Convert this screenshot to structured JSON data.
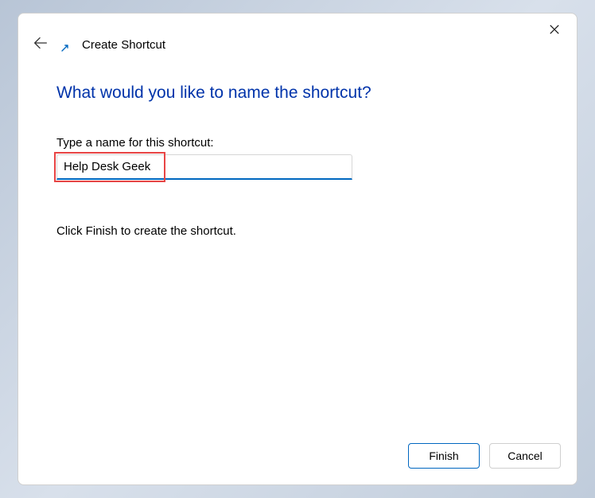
{
  "header": {
    "title": "Create Shortcut"
  },
  "main": {
    "heading": "What would you like to name the shortcut?",
    "field_label": "Type a name for this shortcut:",
    "name_value": "Help Desk Geek",
    "instruction": "Click Finish to create the shortcut."
  },
  "footer": {
    "finish_label": "Finish",
    "cancel_label": "Cancel"
  }
}
